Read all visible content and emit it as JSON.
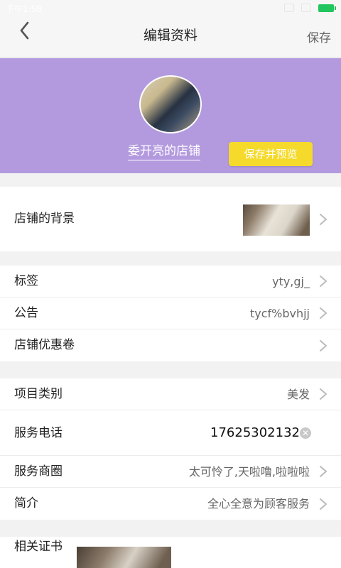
{
  "status_bar": {
    "time": "下午1:58"
  },
  "nav": {
    "title": "编辑资料",
    "save_label": "保存"
  },
  "profile": {
    "shop_name": "委开亮的店铺",
    "preview_button": "保存并预览",
    "banner_color": "#b39ade",
    "button_color": "#f5da2c"
  },
  "background_row": {
    "label": "店铺的背景"
  },
  "tag_rows": [
    {
      "label": "标签",
      "value": "yty,gj_"
    },
    {
      "label": "公告",
      "value": "tycf%bvhjj"
    },
    {
      "label": "店铺优惠卷",
      "value": ""
    }
  ],
  "service_rows": {
    "category": {
      "label": "项目类别",
      "value": "美发"
    },
    "phone": {
      "label": "服务电话",
      "value": "17625302132"
    },
    "area": {
      "label": "服务商圈",
      "value": "太可怜了,天啦噜,啦啦啦"
    },
    "intro": {
      "label": "简介",
      "value": "全心全意为顾客服务"
    }
  },
  "certificates": {
    "label": "相关证书"
  },
  "icons": [
    "back-arrow-icon",
    "chevron-right-icon",
    "clear-icon",
    "battery-icon",
    "wifi-icon",
    "alarm-icon"
  ]
}
